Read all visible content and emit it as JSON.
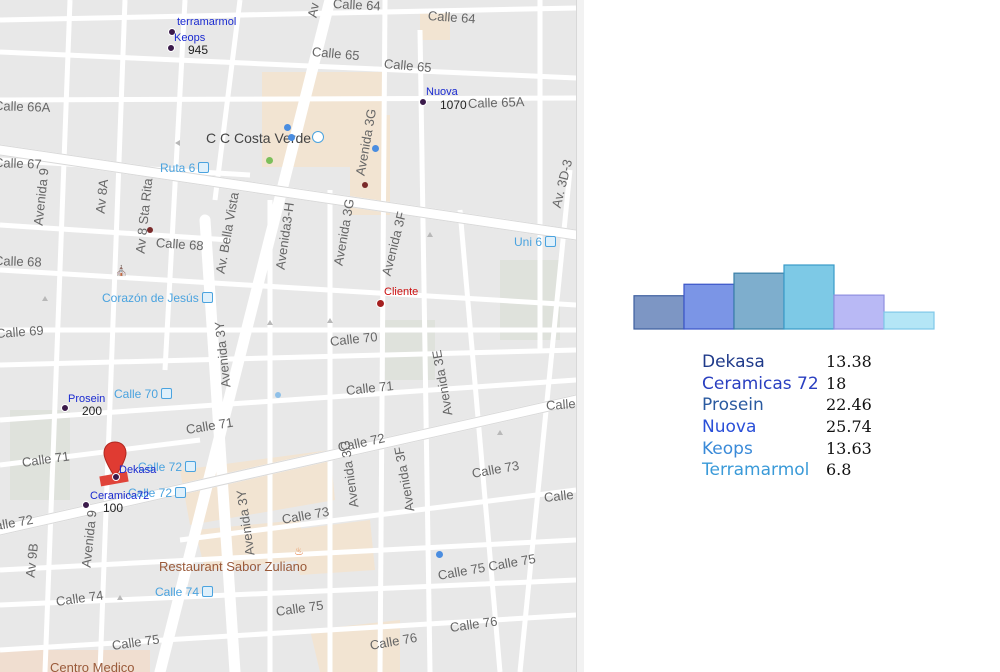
{
  "map": {
    "streets": [
      {
        "id": "calle-64",
        "label": "Calle 64"
      },
      {
        "id": "calle-64-b",
        "label": "Calle 64"
      },
      {
        "id": "calle-65",
        "label": "Calle 65"
      },
      {
        "id": "calle-65-b",
        "label": "Calle 65"
      },
      {
        "id": "calle-65a",
        "label": "Calle 65A"
      },
      {
        "id": "calle-66a",
        "label": "Calle 66A"
      },
      {
        "id": "calle-67",
        "label": "Calle 67"
      },
      {
        "id": "calle-68",
        "label": "Calle 68"
      },
      {
        "id": "calle-68-b",
        "label": "Calle 68"
      },
      {
        "id": "calle-69",
        "label": "Calle 69"
      },
      {
        "id": "calle-70",
        "label": "Calle 70"
      },
      {
        "id": "calle-71",
        "label": "Calle 71"
      },
      {
        "id": "calle-71-b",
        "label": "Calle 71"
      },
      {
        "id": "calle-71-c",
        "label": "Calle 71"
      },
      {
        "id": "calle-72",
        "label": "Calle 72"
      },
      {
        "id": "calle-72-b",
        "label": "Calle 72"
      },
      {
        "id": "calle-73",
        "label": "Calle 73"
      },
      {
        "id": "calle-73-b",
        "label": "Calle 73"
      },
      {
        "id": "calle-74",
        "label": "Calle 74"
      },
      {
        "id": "calle-75",
        "label": "Calle 75"
      },
      {
        "id": "calle-75-b",
        "label": "Calle 75 Calle 75"
      },
      {
        "id": "calle-75-c",
        "label": "Calle 75"
      },
      {
        "id": "calle-76",
        "label": "Calle 76"
      },
      {
        "id": "calle-76-b",
        "label": "Calle 76"
      },
      {
        "id": "calle-edge-1",
        "label": "Calle"
      },
      {
        "id": "calle-edge-2",
        "label": "Calle"
      },
      {
        "id": "avenida-9",
        "label": "Avenida 9"
      },
      {
        "id": "avenida-9-b",
        "label": "Avenida 9"
      },
      {
        "id": "av-8a",
        "label": "Av 8A"
      },
      {
        "id": "av-8-sta-rita",
        "label": "Av 8 Sta Rita"
      },
      {
        "id": "av-bella-vista",
        "label": "Av. Bella Vista"
      },
      {
        "id": "avenida-3h",
        "label": "Avenida3-H"
      },
      {
        "id": "avenida-3g",
        "label": "Avenida 3G"
      },
      {
        "id": "avenida-3g-b",
        "label": "Avenida 3G"
      },
      {
        "id": "avenida-3g-c",
        "label": "Avenida 3G"
      },
      {
        "id": "avenida-3f",
        "label": "Avenida 3F"
      },
      {
        "id": "avenida-3f-b",
        "label": "Avenida 3F"
      },
      {
        "id": "avenida-3e",
        "label": "Avenida 3E"
      },
      {
        "id": "avenida-3y",
        "label": "Avenida 3Y"
      },
      {
        "id": "avenida-3y-b",
        "label": "Avenida 3Y"
      },
      {
        "id": "av-3d-3",
        "label": "Av. 3D-3"
      },
      {
        "id": "av-9b",
        "label": "Av 9B"
      },
      {
        "id": "av-top",
        "label": "Av"
      }
    ],
    "places": [
      {
        "id": "cc-costa-verde",
        "label": "C C Costa Verde"
      },
      {
        "id": "restaurant",
        "label": "Restaurant Sabor Zuliano"
      },
      {
        "id": "centro-medico",
        "label": "Centro Medico"
      }
    ],
    "transit": [
      {
        "id": "ruta-6",
        "label": "Ruta 6"
      },
      {
        "id": "uni-6",
        "label": "Uni 6"
      },
      {
        "id": "corazon-jesus",
        "label": "Corazón de Jesús"
      },
      {
        "id": "calle-70-stop",
        "label": "Calle 70"
      },
      {
        "id": "calle-72-stop",
        "label": "Calle 72"
      },
      {
        "id": "calle-72-stop-b",
        "label": "Calle 72"
      },
      {
        "id": "calle-74-stop",
        "label": "Calle 74"
      }
    ],
    "markers": [
      {
        "id": "terramarmol",
        "name": "terramarmol"
      },
      {
        "id": "keops",
        "name": "Keops",
        "value": "945"
      },
      {
        "id": "nuova",
        "name": "Nuova",
        "value": "1070"
      },
      {
        "id": "prosein",
        "name": "Prosein",
        "value": "200"
      },
      {
        "id": "dekasa",
        "name": "Dekasa"
      },
      {
        "id": "ceramica72",
        "name": "Ceramica72",
        "value": "100"
      }
    ],
    "client": {
      "label": "Cliente",
      "color": "#cc1111"
    },
    "pin_color": "#e03b32"
  },
  "chart_data": {
    "type": "bar",
    "categories": [
      "Dekasa",
      "Ceramicas 72",
      "Prosein",
      "Nuova",
      "Keops",
      "Terramarmol"
    ],
    "values": [
      13.38,
      18,
      22.46,
      25.74,
      13.63,
      6.8
    ],
    "colors": [
      "#7d96c4",
      "#7b95e6",
      "#7eaecd",
      "#7dc9e6",
      "#b9b9f5",
      "#b4e6f6"
    ],
    "edge_colors": [
      "#3e5fa0",
      "#3a55c8",
      "#3a7fa8",
      "#3a9bc8",
      "#8f8fe0",
      "#7fc8e8"
    ]
  },
  "legend": [
    {
      "name": "Dekasa",
      "value": "13.38",
      "color": "#1f3a8a"
    },
    {
      "name": "Ceramicas 72",
      "value": "18",
      "color": "#2a3fc0"
    },
    {
      "name": "Prosein",
      "value": "22.46",
      "color": "#2a5aa0"
    },
    {
      "name": "Nuova",
      "value": "25.74",
      "color": "#2a4fd8"
    },
    {
      "name": "Keops",
      "value": "13.63",
      "color": "#3a8ad8"
    },
    {
      "name": "Terramarmol",
      "value": "6.8",
      "color": "#3a9ad8"
    }
  ]
}
